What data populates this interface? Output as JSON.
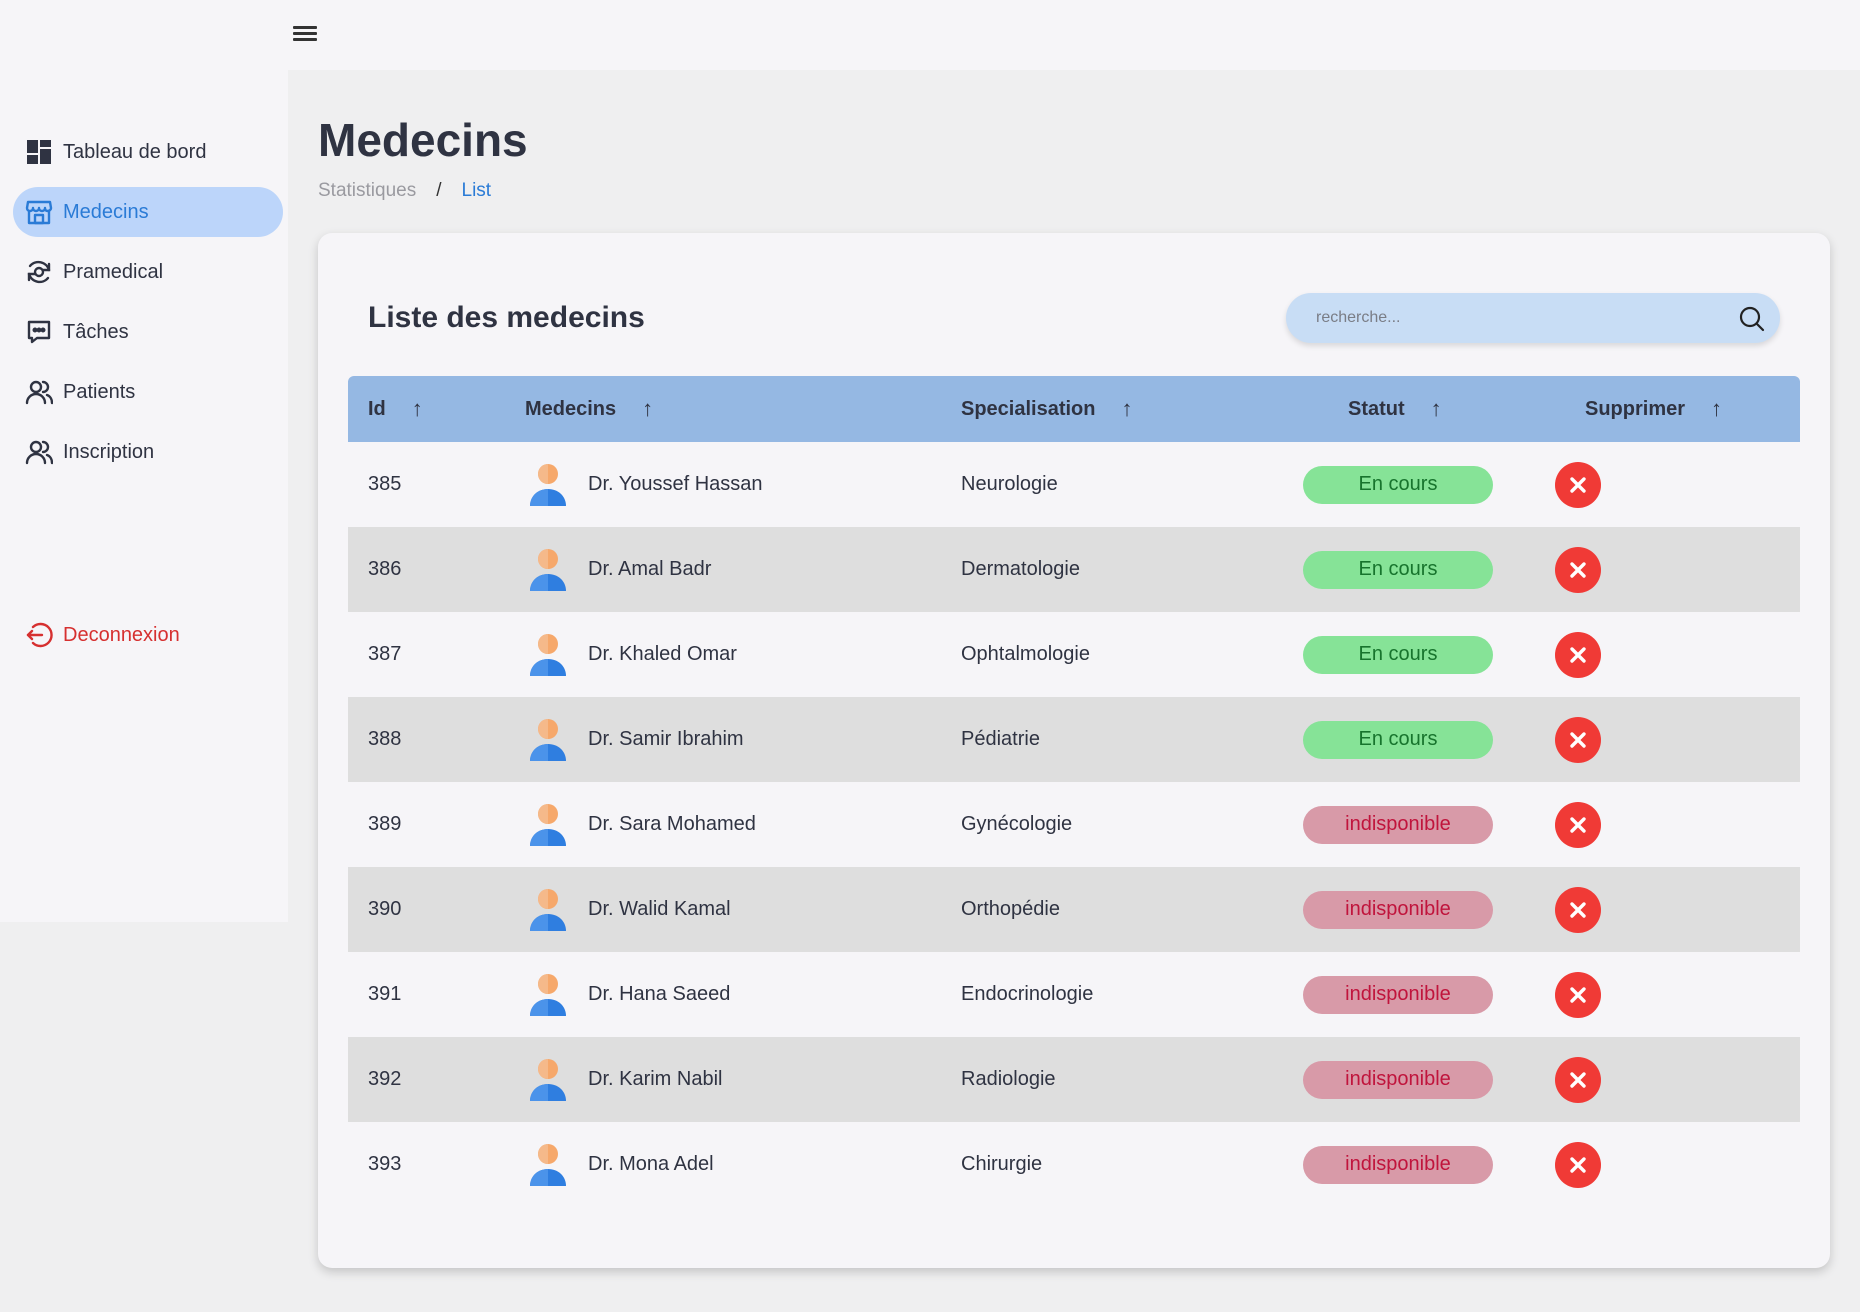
{
  "sidebar": {
    "items": [
      {
        "label": "Tableau de bord",
        "icon": "dashboard-icon"
      },
      {
        "label": "Medecins",
        "icon": "store-icon",
        "active": true
      },
      {
        "label": "Pramedical",
        "icon": "eye-cycle-icon"
      },
      {
        "label": "Tâches",
        "icon": "chat-dots-icon"
      },
      {
        "label": "Patients",
        "icon": "users-icon"
      },
      {
        "label": "Inscription",
        "icon": "users-icon"
      }
    ],
    "logout": {
      "label": "Deconnexion",
      "icon": "logout-icon"
    }
  },
  "page": {
    "title": "Medecins",
    "breadcrumb": {
      "parent": "Statistiques",
      "separator": "/",
      "current": "List"
    }
  },
  "card": {
    "title": "Liste des medecins",
    "search": {
      "placeholder": "recherche..."
    }
  },
  "table": {
    "headers": {
      "id": "Id",
      "medecins": "Medecins",
      "specialisation": "Specialisation",
      "statut": "Statut",
      "supprimer": "Supprimer",
      "sort_arrow": "↑"
    },
    "rows": [
      {
        "id": "385",
        "name": "Dr. Youssef Hassan",
        "specialisation": "Neurologie",
        "statut": "En cours"
      },
      {
        "id": "386",
        "name": "Dr. Amal Badr",
        "specialisation": "Dermatologie",
        "statut": "En cours"
      },
      {
        "id": "387",
        "name": "Dr. Khaled Omar",
        "specialisation": "Ophtalmologie",
        "statut": "En cours"
      },
      {
        "id": "388",
        "name": "Dr. Samir Ibrahim",
        "specialisation": "Pédiatrie",
        "statut": "En cours"
      },
      {
        "id": "389",
        "name": "Dr. Sara Mohamed",
        "specialisation": "Gynécologie",
        "statut": "indisponible"
      },
      {
        "id": "390",
        "name": "Dr. Walid Kamal",
        "specialisation": "Orthopédie",
        "statut": "indisponible"
      },
      {
        "id": "391",
        "name": "Dr. Hana Saeed",
        "specialisation": "Endocrinologie",
        "statut": "indisponible"
      },
      {
        "id": "392",
        "name": "Dr. Karim Nabil",
        "specialisation": "Radiologie",
        "statut": "indisponible"
      },
      {
        "id": "393",
        "name": "Dr. Mona Adel",
        "specialisation": "Chirurgie",
        "statut": "indisponible"
      }
    ]
  },
  "colors": {
    "accent": "#2a7bd6",
    "active_bg": "#bcd5fa",
    "header_bg": "#95b8e3",
    "status_ok_bg": "#86e397",
    "status_ko_bg": "#d89aa8",
    "delete": "#f03a36",
    "logout": "#d63030"
  }
}
